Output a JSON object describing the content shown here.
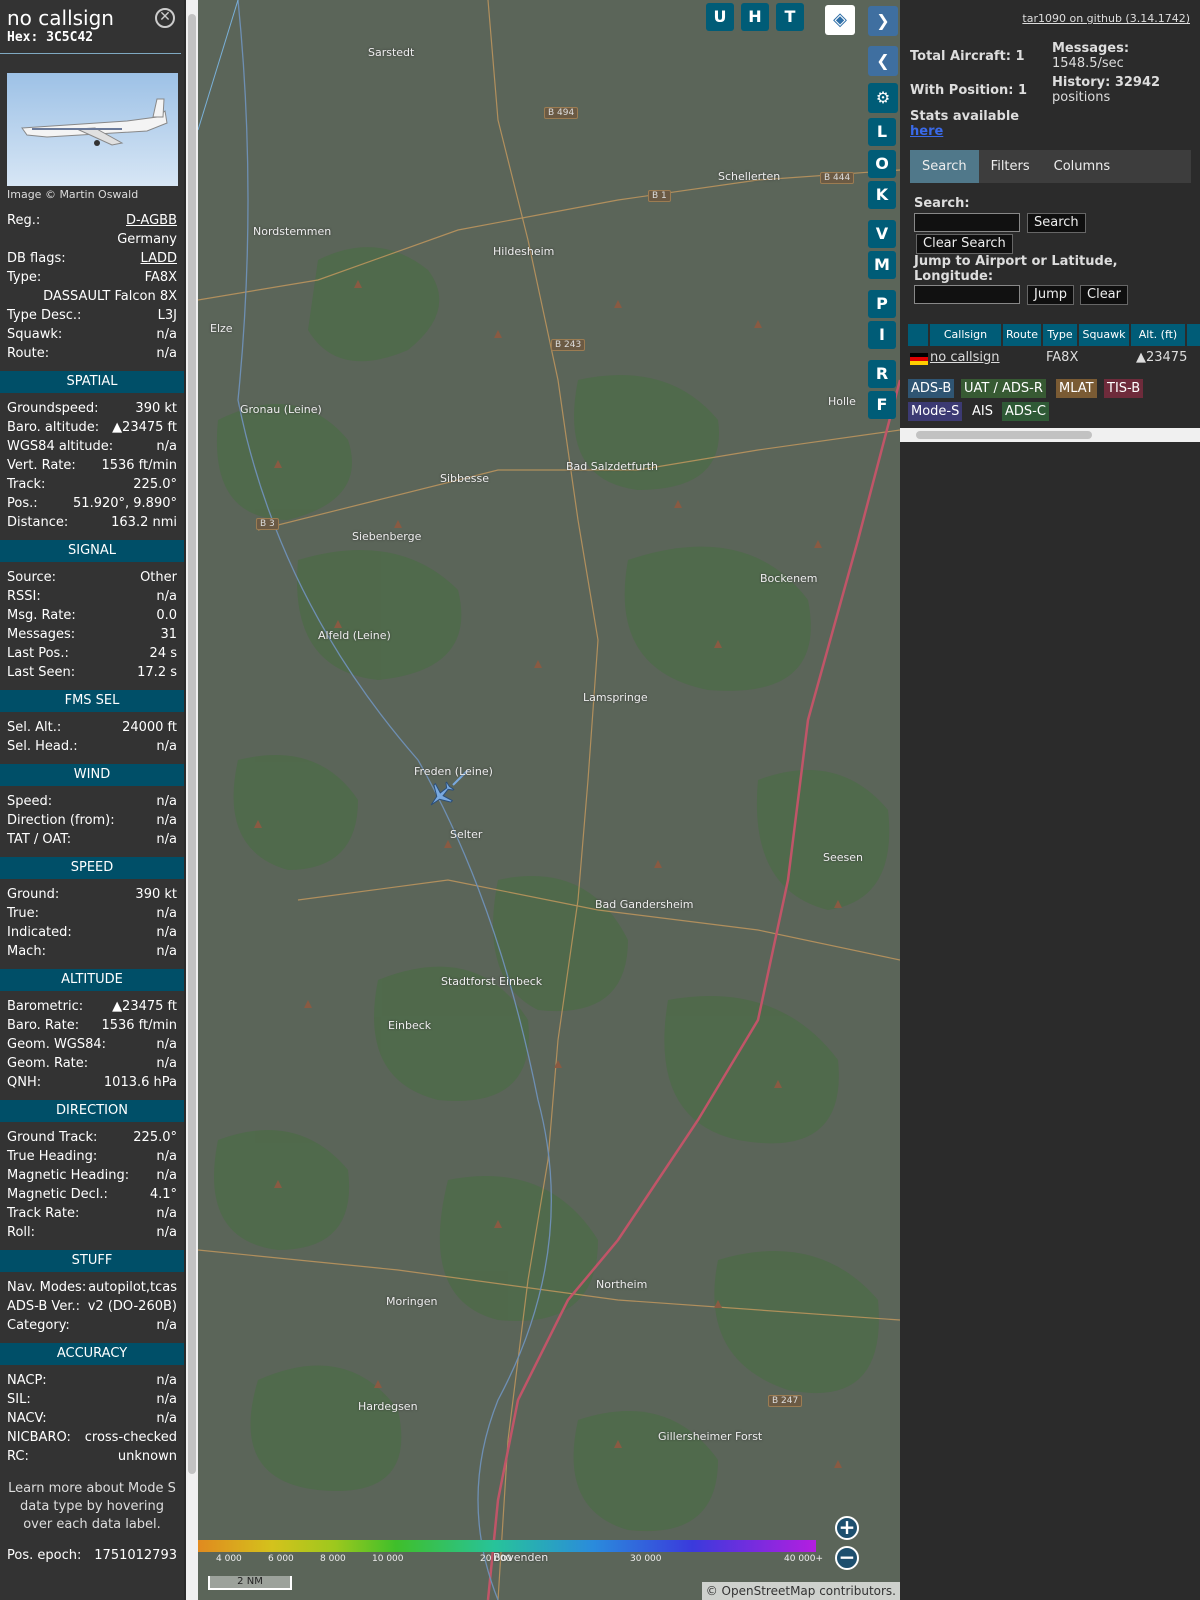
{
  "sidebar": {
    "callsign": "no callsign",
    "hex": "Hex: 3C5C42",
    "image_credit": "Image © Martin Oswald",
    "info": [
      {
        "label": "Reg.:",
        "value": "D-AGBB",
        "link": true
      },
      {
        "label": "",
        "value": "Germany"
      },
      {
        "label": "DB flags:",
        "value": "LADD",
        "link": true
      },
      {
        "label": "Type:",
        "value": "FA8X"
      },
      {
        "label": "",
        "value": "DASSAULT Falcon 8X"
      },
      {
        "label": "Type Desc.:",
        "value": "L3J"
      },
      {
        "label": "Squawk:",
        "value": "n/a"
      },
      {
        "label": "Route:",
        "value": "n/a"
      }
    ],
    "sections": [
      {
        "title": "SPATIAL",
        "rows": [
          {
            "label": "Groundspeed:",
            "value": "390 kt"
          },
          {
            "label": "Baro. altitude:",
            "value": "▲23475 ft"
          },
          {
            "label": "WGS84 altitude:",
            "value": "n/a"
          },
          {
            "label": "Vert. Rate:",
            "value": "1536 ft/min"
          },
          {
            "label": "Track:",
            "value": "225.0°"
          },
          {
            "label": "Pos.:",
            "value": "51.920°, 9.890°"
          },
          {
            "label": "Distance:",
            "value": "163.2 nmi"
          }
        ]
      },
      {
        "title": "SIGNAL",
        "rows": [
          {
            "label": "Source:",
            "value": "Other"
          },
          {
            "label": "RSSI:",
            "value": "n/a"
          },
          {
            "label": "Msg. Rate:",
            "value": "0.0"
          },
          {
            "label": "Messages:",
            "value": "31"
          },
          {
            "label": "Last Pos.:",
            "value": "24 s"
          },
          {
            "label": "Last Seen:",
            "value": "17.2 s"
          }
        ]
      },
      {
        "title": "FMS SEL",
        "rows": [
          {
            "label": "Sel. Alt.:",
            "value": "24000 ft"
          },
          {
            "label": "Sel. Head.:",
            "value": "n/a"
          }
        ]
      },
      {
        "title": "WIND",
        "rows": [
          {
            "label": "Speed:",
            "value": "n/a"
          },
          {
            "label": "Direction (from):",
            "value": "n/a"
          },
          {
            "label": "TAT / OAT:",
            "value": "n/a"
          }
        ]
      },
      {
        "title": "SPEED",
        "rows": [
          {
            "label": "Ground:",
            "value": "390 kt"
          },
          {
            "label": "True:",
            "value": "n/a"
          },
          {
            "label": "Indicated:",
            "value": "n/a"
          },
          {
            "label": "Mach:",
            "value": "n/a"
          }
        ]
      },
      {
        "title": "ALTITUDE",
        "rows": [
          {
            "label": "Barometric:",
            "value": "▲23475 ft"
          },
          {
            "label": "Baro. Rate:",
            "value": "1536 ft/min"
          },
          {
            "label": "Geom. WGS84:",
            "value": "n/a"
          },
          {
            "label": "Geom. Rate:",
            "value": "n/a"
          },
          {
            "label": "QNH:",
            "value": "1013.6 hPa"
          }
        ]
      },
      {
        "title": "DIRECTION",
        "rows": [
          {
            "label": "Ground Track:",
            "value": "225.0°"
          },
          {
            "label": "True Heading:",
            "value": "n/a"
          },
          {
            "label": "Magnetic Heading:",
            "value": "n/a"
          },
          {
            "label": "Magnetic Decl.:",
            "value": "4.1°"
          },
          {
            "label": "Track Rate:",
            "value": "n/a"
          },
          {
            "label": "Roll:",
            "value": "n/a"
          }
        ]
      },
      {
        "title": "STUFF",
        "rows": [
          {
            "label": "Nav. Modes:",
            "value": "autopilot,tcas"
          },
          {
            "label": "ADS-B Ver.:",
            "value": "v2 (DO-260B)"
          },
          {
            "label": "Category:",
            "value": "n/a"
          }
        ]
      },
      {
        "title": "ACCURACY",
        "rows": [
          {
            "label": "NACP:",
            "value": "n/a"
          },
          {
            "label": "SIL:",
            "value": "n/a"
          },
          {
            "label": "NACV:",
            "value": "n/a"
          },
          {
            "label": "NICBARO:",
            "value": "cross-checked"
          },
          {
            "label": "RC:",
            "value": "unknown"
          }
        ]
      }
    ],
    "learn_more": "Learn more about Mode S data type by hovering over each data label.",
    "pos_epoch_label": "Pos. epoch:",
    "pos_epoch_value": "1751012793"
  },
  "map": {
    "buttons_top": [
      "U",
      "H",
      "T"
    ],
    "side_buttons": [
      "L",
      "O",
      "K",
      "V",
      "M",
      "P",
      "I",
      "R",
      "F"
    ],
    "places": [
      {
        "name": "Sarstedt"
      },
      {
        "name": "Nordstemmen"
      },
      {
        "name": "Hildesheim"
      },
      {
        "name": "Schellerten"
      },
      {
        "name": "Elze"
      },
      {
        "name": "Gronau (Leine)"
      },
      {
        "name": "Sibbesse"
      },
      {
        "name": "Bad Salzdetfurth"
      },
      {
        "name": "Siebenberge"
      },
      {
        "name": "Bockenem"
      },
      {
        "name": "Alfeld (Leine)"
      },
      {
        "name": "Lamspringe"
      },
      {
        "name": "Freden (Leine)"
      },
      {
        "name": "Selter"
      },
      {
        "name": "Seesen"
      },
      {
        "name": "Bad Gandersheim"
      },
      {
        "name": "Stadtforst Einbeck"
      },
      {
        "name": "Einbeck"
      },
      {
        "name": "Northeim"
      },
      {
        "name": "Moringen"
      },
      {
        "name": "Hardegsen"
      },
      {
        "name": "Gillersheimer Forst"
      },
      {
        "name": "Bovenden"
      },
      {
        "name": "Holle"
      }
    ],
    "roads": [
      "B 494",
      "B 1",
      "B 444",
      "B 243",
      "B 3",
      "B 247"
    ],
    "legend_ticks": [
      "4 000",
      "6 000",
      "8 000",
      "10 000",
      "20 000",
      "30 000",
      "40 000+"
    ],
    "scale": "2 NM",
    "attribution": "© OpenStreetMap contributors."
  },
  "panel": {
    "github": "tar1090 on github (3.14.1742)",
    "total_aircraft": "Total Aircraft: 1",
    "with_position": "With Position: 1",
    "messages_label": "Messages:",
    "messages_value": "1548.5/sec",
    "history_label": "History: 32942",
    "history_value": "positions",
    "stats": "Stats available",
    "stats_link": "here",
    "tabs": [
      "Search",
      "Filters",
      "Columns"
    ],
    "search_label": "Search:",
    "search_button": "Search",
    "clear_search_button": "Clear Search",
    "jump_label": "Jump to Airport or Latitude, Longitude:",
    "jump_button": "Jump",
    "clear_button": "Clear",
    "table_headers": [
      "Callsign",
      "Route",
      "Type",
      "Squawk",
      "Alt. (ft)"
    ],
    "table_rows": [
      {
        "callsign": "no callsign",
        "route": "",
        "type": "FA8X",
        "squawk": "",
        "alt": "▲23475"
      }
    ],
    "source_tags": [
      "ADS-B",
      "UAT / ADS-R",
      "MLAT",
      "TIS-B",
      "Mode-S",
      "AIS",
      "ADS-C"
    ],
    "colors": {
      "adsb": "#2f5573",
      "uat": "#375a33",
      "mlat": "#7a5b34",
      "tisb": "#6e2b3b",
      "modes": "#3c3a73",
      "ais": "#2b2b2b",
      "adsc": "#2f5a36"
    }
  }
}
